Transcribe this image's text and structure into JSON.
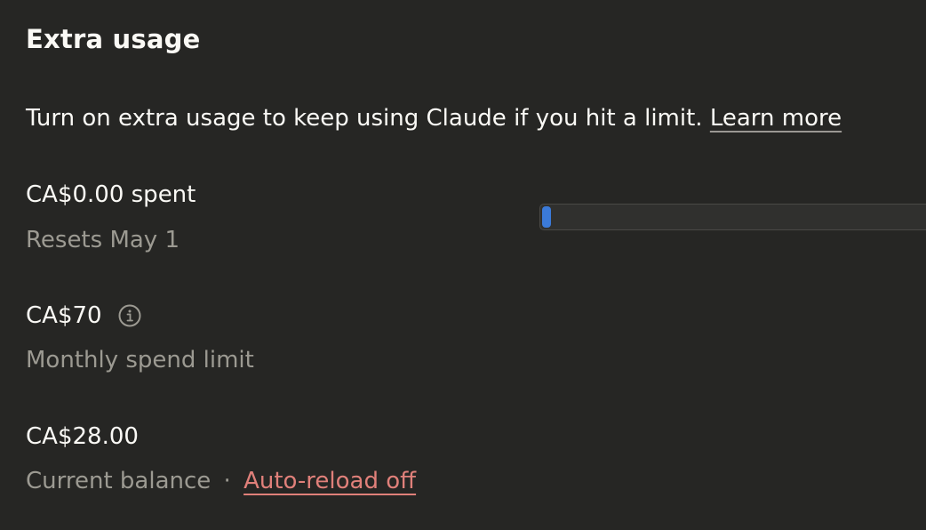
{
  "section": {
    "title": "Extra usage",
    "description": "Turn on extra usage to keep using Claude if you hit a limit.",
    "learn_more_link": "Learn more"
  },
  "usage": {
    "spent_label": "CA$0.00 spent",
    "resets_label": "Resets May 1",
    "progress_fraction": 0.0
  },
  "limit": {
    "amount": "CA$70",
    "info_icon": "info-icon",
    "label": "Monthly spend limit"
  },
  "balance": {
    "amount": "CA$28.00",
    "label": "Current balance",
    "separator": "·",
    "auto_reload_link": "Auto-reload off"
  },
  "colors": {
    "background": "#262624",
    "primary_text": "#faf9f5",
    "secondary_text": "#9c9a92",
    "progress_fill": "#3b7ad8",
    "auto_reload_link": "#e0807a"
  }
}
